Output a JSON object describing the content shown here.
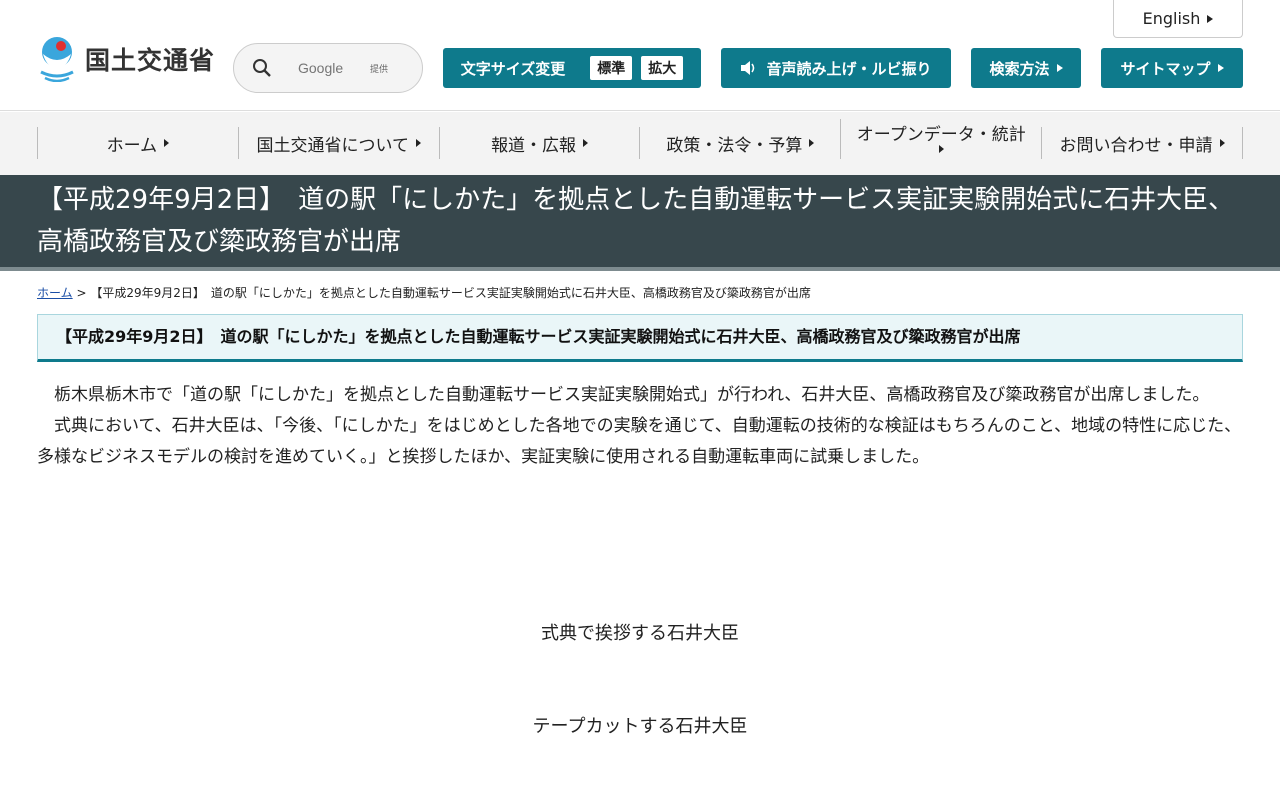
{
  "header": {
    "logo_text": "国土交通省",
    "search_placeholder": "Google",
    "search_provider": "提供",
    "english_label": "English",
    "font_size_label": "文字サイズ変更",
    "font_size_standard": "標準",
    "font_size_large": "拡大",
    "voice_label": "音声読み上げ・ルビ振り",
    "search_method_label": "検索方法",
    "sitemap_label": "サイトマップ"
  },
  "nav": {
    "items": [
      {
        "label": "ホーム"
      },
      {
        "label": "国土交通省について"
      },
      {
        "label": "報道・広報"
      },
      {
        "label": "政策・法令・予算"
      },
      {
        "label": "オープンデータ・統計"
      },
      {
        "label": "お問い合わせ・申請"
      }
    ]
  },
  "page": {
    "title": "【平成29年9月2日】　道の駅「にしかた」を拠点とした自動運転サービス実証実験開始式に石井大臣、高橋政務官及び簗政務官が出席",
    "breadcrumb_home": "ホーム",
    "breadcrumb_sep": ">",
    "breadcrumb_current": "【平成29年9月2日】　道の駅「にしかた」を拠点とした自動運転サービス実証実験開始式に石井大臣、高橋政務官及び簗政務官が出席",
    "heading": "【平成29年9月2日】　道の駅「にしかた」を拠点とした自動運転サービス実証実験開始式に石井大臣、高橋政務官及び簗政務官が出席",
    "paragraph1": "栃木県栃木市で「道の駅「にしかた」を拠点とした自動運転サービス実証実験開始式」が行われ、石井大臣、高橋政務官及び簗政務官が出席しました。",
    "paragraph2": "式典において、石井大臣は、「今後、「にしかた」をはじめとした各地での実験を通じて、自動運転の技術的な検証はもちろんのこと、地域の特性に応じた、多様なビジネスモデルの検討を進めていく。」と挨拶したほか、実証実験に使用される自動運転車両に試乗しました。",
    "caption1": "式典で挨拶する石井大臣",
    "caption2": "テープカットする石井大臣"
  },
  "colors": {
    "accent": "#0e7a8c",
    "title_band": "#37474c",
    "heading_bg": "#eaf6f8"
  }
}
